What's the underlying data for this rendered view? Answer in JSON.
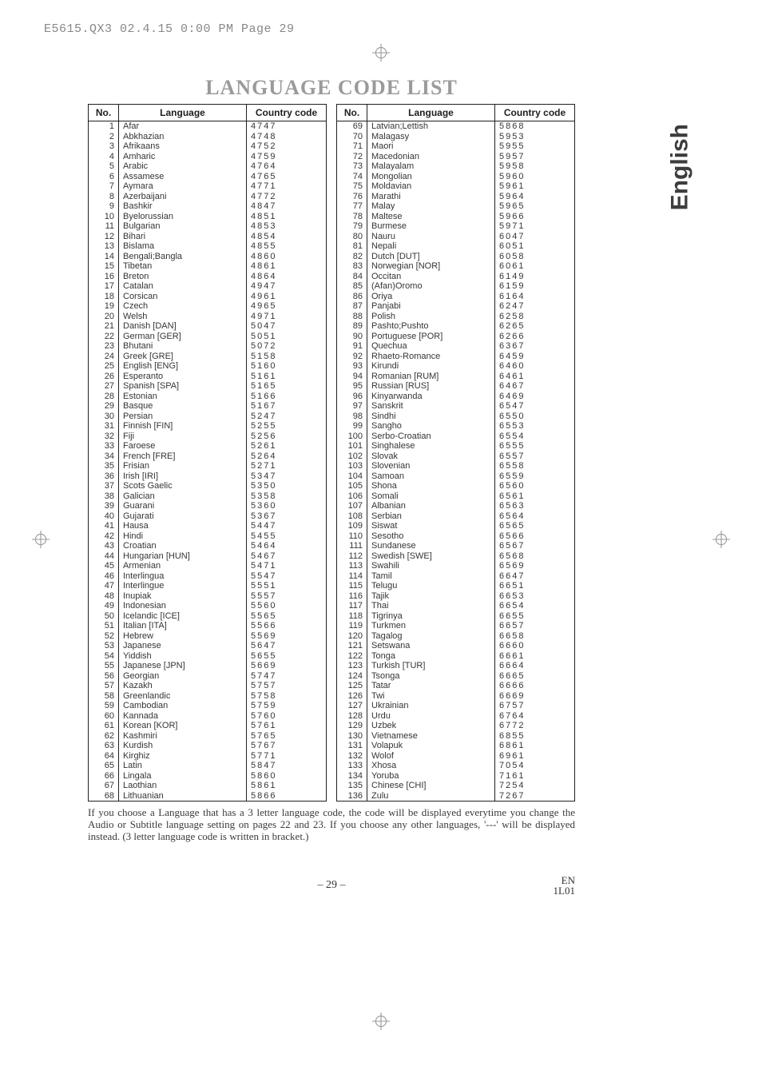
{
  "header_slug": "E5615.QX3  02.4.15 0:00 PM  Page 29",
  "title": "LANGUAGE CODE LIST",
  "tab_label": "English",
  "col_labels": {
    "no": "No.",
    "lang": "Language",
    "code": "Country code"
  },
  "languages": [
    {
      "no": 1,
      "name": "Afar",
      "code": "4747"
    },
    {
      "no": 2,
      "name": "Abkhazian",
      "code": "4748"
    },
    {
      "no": 3,
      "name": "Afrikaans",
      "code": "4752"
    },
    {
      "no": 4,
      "name": "Amharic",
      "code": "4759"
    },
    {
      "no": 5,
      "name": "Arabic",
      "code": "4764"
    },
    {
      "no": 6,
      "name": "Assamese",
      "code": "4765"
    },
    {
      "no": 7,
      "name": "Aymara",
      "code": "4771"
    },
    {
      "no": 8,
      "name": "Azerbaijani",
      "code": "4772"
    },
    {
      "no": 9,
      "name": "Bashkir",
      "code": "4847"
    },
    {
      "no": 10,
      "name": "Byelorussian",
      "code": "4851"
    },
    {
      "no": 11,
      "name": "Bulgarian",
      "code": "4853"
    },
    {
      "no": 12,
      "name": "Bihari",
      "code": "4854"
    },
    {
      "no": 13,
      "name": "Bislama",
      "code": "4855"
    },
    {
      "no": 14,
      "name": "Bengali;Bangla",
      "code": "4860"
    },
    {
      "no": 15,
      "name": "Tibetan",
      "code": "4861"
    },
    {
      "no": 16,
      "name": "Breton",
      "code": "4864"
    },
    {
      "no": 17,
      "name": "Catalan",
      "code": "4947"
    },
    {
      "no": 18,
      "name": "Corsican",
      "code": "4961"
    },
    {
      "no": 19,
      "name": "Czech",
      "code": "4965"
    },
    {
      "no": 20,
      "name": "Welsh",
      "code": "4971"
    },
    {
      "no": 21,
      "name": "Danish [DAN]",
      "code": "5047"
    },
    {
      "no": 22,
      "name": "German [GER]",
      "code": "5051"
    },
    {
      "no": 23,
      "name": "Bhutani",
      "code": "5072"
    },
    {
      "no": 24,
      "name": "Greek [GRE]",
      "code": "5158"
    },
    {
      "no": 25,
      "name": "English [ENG]",
      "code": "5160"
    },
    {
      "no": 26,
      "name": "Esperanto",
      "code": "5161"
    },
    {
      "no": 27,
      "name": "Spanish [SPA]",
      "code": "5165"
    },
    {
      "no": 28,
      "name": "Estonian",
      "code": "5166"
    },
    {
      "no": 29,
      "name": "Basque",
      "code": "5167"
    },
    {
      "no": 30,
      "name": "Persian",
      "code": "5247"
    },
    {
      "no": 31,
      "name": "Finnish [FIN]",
      "code": "5255"
    },
    {
      "no": 32,
      "name": "Fiji",
      "code": "5256"
    },
    {
      "no": 33,
      "name": "Faroese",
      "code": "5261"
    },
    {
      "no": 34,
      "name": "French [FRE]",
      "code": "5264"
    },
    {
      "no": 35,
      "name": "Frisian",
      "code": "5271"
    },
    {
      "no": 36,
      "name": "Irish [IRI]",
      "code": "5347"
    },
    {
      "no": 37,
      "name": "Scots Gaelic",
      "code": "5350"
    },
    {
      "no": 38,
      "name": "Galician",
      "code": "5358"
    },
    {
      "no": 39,
      "name": "Guarani",
      "code": "5360"
    },
    {
      "no": 40,
      "name": "Gujarati",
      "code": "5367"
    },
    {
      "no": 41,
      "name": "Hausa",
      "code": "5447"
    },
    {
      "no": 42,
      "name": "Hindi",
      "code": "5455"
    },
    {
      "no": 43,
      "name": "Croatian",
      "code": "5464"
    },
    {
      "no": 44,
      "name": "Hungarian [HUN]",
      "code": "5467"
    },
    {
      "no": 45,
      "name": "Armenian",
      "code": "5471"
    },
    {
      "no": 46,
      "name": "Interlingua",
      "code": "5547"
    },
    {
      "no": 47,
      "name": "Interlingue",
      "code": "5551"
    },
    {
      "no": 48,
      "name": "Inupiak",
      "code": "5557"
    },
    {
      "no": 49,
      "name": "Indonesian",
      "code": "5560"
    },
    {
      "no": 50,
      "name": "Icelandic [ICE]",
      "code": "5565"
    },
    {
      "no": 51,
      "name": "Italian [ITA]",
      "code": "5566"
    },
    {
      "no": 52,
      "name": "Hebrew",
      "code": "5569"
    },
    {
      "no": 53,
      "name": "Japanese",
      "code": "5647"
    },
    {
      "no": 54,
      "name": "Yiddish",
      "code": "5655"
    },
    {
      "no": 55,
      "name": "Japanese [JPN]",
      "code": "5669"
    },
    {
      "no": 56,
      "name": "Georgian",
      "code": "5747"
    },
    {
      "no": 57,
      "name": "Kazakh",
      "code": "5757"
    },
    {
      "no": 58,
      "name": "Greenlandic",
      "code": "5758"
    },
    {
      "no": 59,
      "name": "Cambodian",
      "code": "5759"
    },
    {
      "no": 60,
      "name": "Kannada",
      "code": "5760"
    },
    {
      "no": 61,
      "name": "Korean [KOR]",
      "code": "5761"
    },
    {
      "no": 62,
      "name": "Kashmiri",
      "code": "5765"
    },
    {
      "no": 63,
      "name": "Kurdish",
      "code": "5767"
    },
    {
      "no": 64,
      "name": "Kirghiz",
      "code": "5771"
    },
    {
      "no": 65,
      "name": "Latin",
      "code": "5847"
    },
    {
      "no": 66,
      "name": "Lingala",
      "code": "5860"
    },
    {
      "no": 67,
      "name": "Laothian",
      "code": "5861"
    },
    {
      "no": 68,
      "name": "Lithuanian",
      "code": "5866"
    },
    {
      "no": 69,
      "name": "Latvian;Lettish",
      "code": "5868"
    },
    {
      "no": 70,
      "name": "Malagasy",
      "code": "5953"
    },
    {
      "no": 71,
      "name": "Maori",
      "code": "5955"
    },
    {
      "no": 72,
      "name": "Macedonian",
      "code": "5957"
    },
    {
      "no": 73,
      "name": "Malayalam",
      "code": "5958"
    },
    {
      "no": 74,
      "name": "Mongolian",
      "code": "5960"
    },
    {
      "no": 75,
      "name": "Moldavian",
      "code": "5961"
    },
    {
      "no": 76,
      "name": "Marathi",
      "code": "5964"
    },
    {
      "no": 77,
      "name": "Malay",
      "code": "5965"
    },
    {
      "no": 78,
      "name": "Maltese",
      "code": "5966"
    },
    {
      "no": 79,
      "name": "Burmese",
      "code": "5971"
    },
    {
      "no": 80,
      "name": "Nauru",
      "code": "6047"
    },
    {
      "no": 81,
      "name": "Nepali",
      "code": "6051"
    },
    {
      "no": 82,
      "name": "Dutch [DUT]",
      "code": "6058"
    },
    {
      "no": 83,
      "name": "Norwegian [NOR]",
      "code": "6061"
    },
    {
      "no": 84,
      "name": "Occitan",
      "code": "6149"
    },
    {
      "no": 85,
      "name": "(Afan)Oromo",
      "code": "6159"
    },
    {
      "no": 86,
      "name": "Oriya",
      "code": "6164"
    },
    {
      "no": 87,
      "name": "Panjabi",
      "code": "6247"
    },
    {
      "no": 88,
      "name": "Polish",
      "code": "6258"
    },
    {
      "no": 89,
      "name": "Pashto;Pushto",
      "code": "6265"
    },
    {
      "no": 90,
      "name": "Portuguese [POR]",
      "code": "6266"
    },
    {
      "no": 91,
      "name": "Quechua",
      "code": "6367"
    },
    {
      "no": 92,
      "name": "Rhaeto-Romance",
      "code": "6459"
    },
    {
      "no": 93,
      "name": "Kirundi",
      "code": "6460"
    },
    {
      "no": 94,
      "name": "Romanian [RUM]",
      "code": "6461"
    },
    {
      "no": 95,
      "name": "Russian [RUS]",
      "code": "6467"
    },
    {
      "no": 96,
      "name": "Kinyarwanda",
      "code": "6469"
    },
    {
      "no": 97,
      "name": "Sanskrit",
      "code": "6547"
    },
    {
      "no": 98,
      "name": "Sindhi",
      "code": "6550"
    },
    {
      "no": 99,
      "name": "Sangho",
      "code": "6553"
    },
    {
      "no": 100,
      "name": "Serbo-Croatian",
      "code": "6554"
    },
    {
      "no": 101,
      "name": "Singhalese",
      "code": "6555"
    },
    {
      "no": 102,
      "name": "Slovak",
      "code": "6557"
    },
    {
      "no": 103,
      "name": "Slovenian",
      "code": "6558"
    },
    {
      "no": 104,
      "name": "Samoan",
      "code": "6559"
    },
    {
      "no": 105,
      "name": "Shona",
      "code": "6560"
    },
    {
      "no": 106,
      "name": "Somali",
      "code": "6561"
    },
    {
      "no": 107,
      "name": "Albanian",
      "code": "6563"
    },
    {
      "no": 108,
      "name": "Serbian",
      "code": "6564"
    },
    {
      "no": 109,
      "name": "Siswat",
      "code": "6565"
    },
    {
      "no": 110,
      "name": "Sesotho",
      "code": "6566"
    },
    {
      "no": 111,
      "name": "Sundanese",
      "code": "6567"
    },
    {
      "no": 112,
      "name": "Swedish [SWE]",
      "code": "6568"
    },
    {
      "no": 113,
      "name": "Swahili",
      "code": "6569"
    },
    {
      "no": 114,
      "name": "Tamil",
      "code": "6647"
    },
    {
      "no": 115,
      "name": "Telugu",
      "code": "6651"
    },
    {
      "no": 116,
      "name": "Tajik",
      "code": "6653"
    },
    {
      "no": 117,
      "name": "Thai",
      "code": "6654"
    },
    {
      "no": 118,
      "name": "Tigrinya",
      "code": "6655"
    },
    {
      "no": 119,
      "name": "Turkmen",
      "code": "6657"
    },
    {
      "no": 120,
      "name": "Tagalog",
      "code": "6658"
    },
    {
      "no": 121,
      "name": "Setswana",
      "code": "6660"
    },
    {
      "no": 122,
      "name": "Tonga",
      "code": "6661"
    },
    {
      "no": 123,
      "name": "Turkish [TUR]",
      "code": "6664"
    },
    {
      "no": 124,
      "name": "Tsonga",
      "code": "6665"
    },
    {
      "no": 125,
      "name": "Tatar",
      "code": "6666"
    },
    {
      "no": 126,
      "name": "Twi",
      "code": "6669"
    },
    {
      "no": 127,
      "name": "Ukrainian",
      "code": "6757"
    },
    {
      "no": 128,
      "name": "Urdu",
      "code": "6764"
    },
    {
      "no": 129,
      "name": "Uzbek",
      "code": "6772"
    },
    {
      "no": 130,
      "name": "Vietnamese",
      "code": "6855"
    },
    {
      "no": 131,
      "name": "Volapuk",
      "code": "6861"
    },
    {
      "no": 132,
      "name": "Wolof",
      "code": "6961"
    },
    {
      "no": 133,
      "name": "Xhosa",
      "code": "7054"
    },
    {
      "no": 134,
      "name": "Yoruba",
      "code": "7161"
    },
    {
      "no": 135,
      "name": "Chinese [CHI]",
      "code": "7254"
    },
    {
      "no": 136,
      "name": "Zulu",
      "code": "7267"
    }
  ],
  "footer_note": "If you choose a Language that has a 3 letter language code, the code will be displayed everytime you change the Audio or Subtitle language setting on pages 22 and 23. If you choose any other languages, '---' will be displayed instead. (3 letter language code is written in bracket.)",
  "page_no": "– 29 –",
  "doc_id_line1": "EN",
  "doc_id_line2": "1L01"
}
